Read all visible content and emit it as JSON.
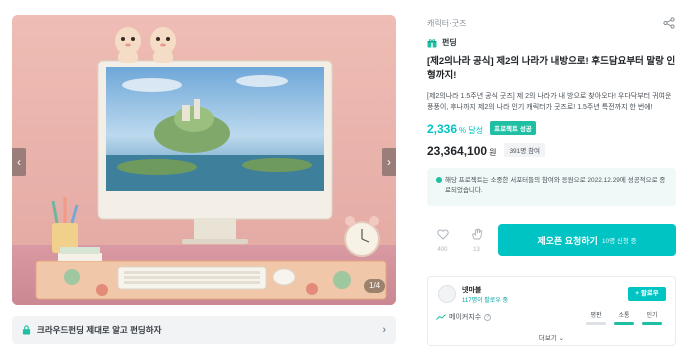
{
  "gallery": {
    "counter": "1/4",
    "prev_icon": "chevron-left-icon",
    "next_icon": "chevron-right-icon"
  },
  "guide": {
    "text": "크라우드펀딩 제대로 알고 펀딩하자",
    "icon": "lock-icon"
  },
  "header": {
    "category": "캐릭터·굿즈",
    "share_icon": "share-icon"
  },
  "project": {
    "type_label": "펀딩",
    "title": "[제2의나라 공식] 제2의 나라가 내방으로! 후드담요부터 말랑 인형까지!",
    "description": "[제2의나라 1.5주년 공식 굿즈] 제 2의 나라가 내 방으로 찾아오다! 우다닥부터 귀여운 풍풍이, 후나까지 제2의 나라 인기 캐릭터가 굿즈로! 1.5주년 특전까지 한 번에!",
    "achievement_rate": "2,336",
    "rate_unit": "% 달성",
    "success_badge": "프로젝트 성공",
    "amount": "23,364,100",
    "currency": "원",
    "supporters": "391명 참여",
    "notice": "해당 프로젝트는 소중한 서포터들의 참여와 응원으로 2022.12.29에 성공적으로 종료되었습니다."
  },
  "actions": {
    "like_count": "400",
    "cheer_count": "13",
    "cta_label": "제오픈 요청하기",
    "cta_sub": "10명 신청 중"
  },
  "maker": {
    "name": "넷마블",
    "followers": "117명이 팔로우 중",
    "follow_label": "+ 팔로우",
    "index_label": "메이커지수",
    "metrics": [
      {
        "label": "평판",
        "active": false
      },
      {
        "label": "소통",
        "active": true
      },
      {
        "label": "인기",
        "active": true
      }
    ],
    "more_label": "더보기 ⌄"
  },
  "colors": {
    "accent": "#00c4c4",
    "success": "#1ebfa3",
    "notice_bg": "#f1f9f8"
  }
}
